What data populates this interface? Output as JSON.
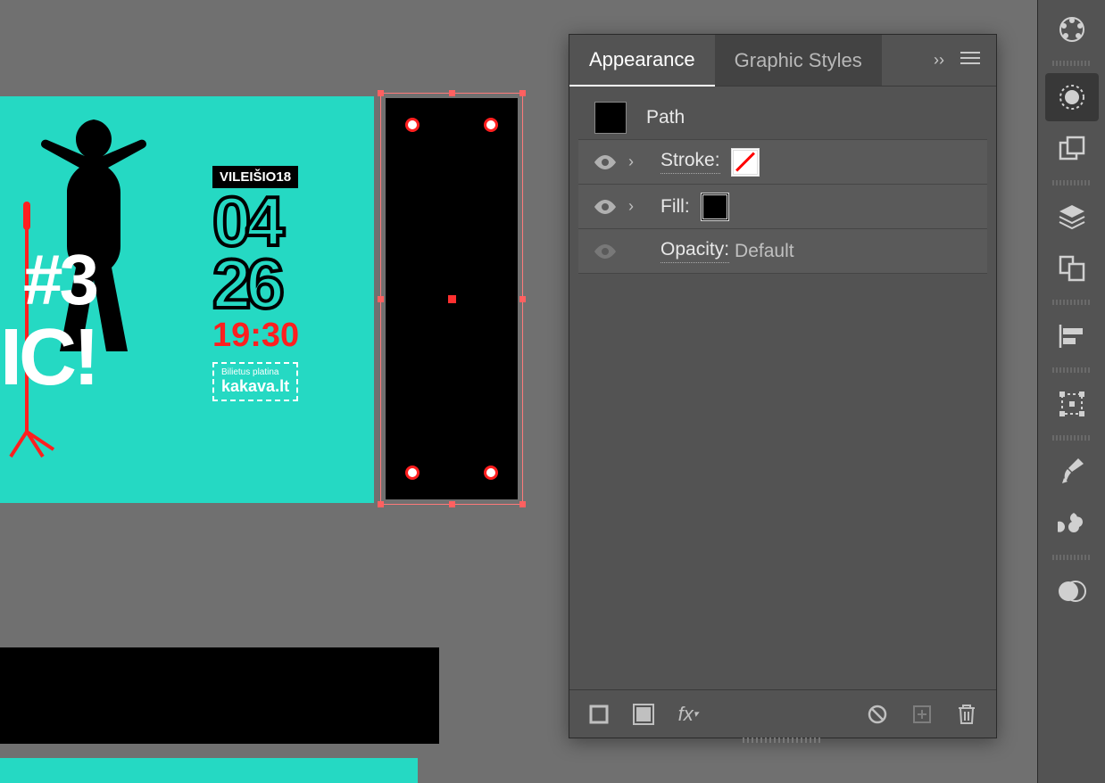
{
  "panel": {
    "tabs": {
      "appearance": "Appearance",
      "graphic_styles": "Graphic Styles"
    },
    "object_type": "Path",
    "stroke_label": "Stroke:",
    "fill_label": "Fill:",
    "opacity_label": "Opacity:",
    "opacity_value": "Default"
  },
  "artwork": {
    "venue": "VILEIŠIO18",
    "month": "04",
    "day": "26",
    "time": "19:30",
    "hash": "#3",
    "ic": "IC!",
    "ticket_label": "Bilietus platina",
    "ticket_brand": "kakava.lt"
  },
  "colors": {
    "teal": "#25d9c3",
    "red": "#ff1f1f",
    "selection": "#ff6060"
  }
}
